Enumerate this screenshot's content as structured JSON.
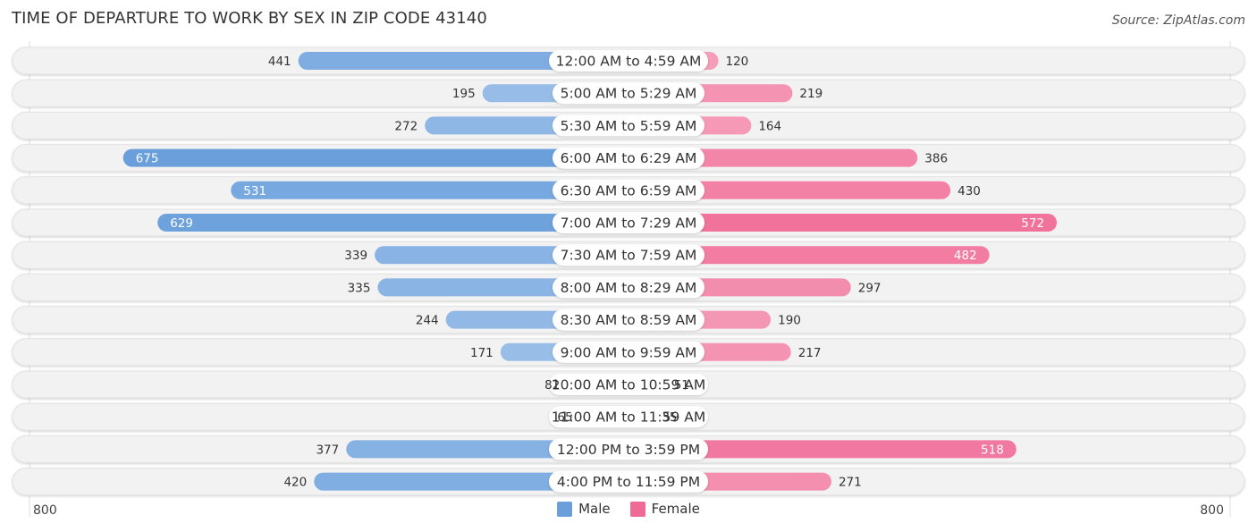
{
  "header": {
    "title": "TIME OF DEPARTURE TO WORK BY SEX IN ZIP CODE 43140",
    "source": "Source: ZipAtlas.com"
  },
  "colors": {
    "male": "#6a9fdc",
    "male_light": "#a8c8ec",
    "female": "#f06a96",
    "female_light": "#f6a8c0",
    "track": "#f2f2f2"
  },
  "legend": {
    "male_label": "Male",
    "female_label": "Female"
  },
  "axis": {
    "left_label": "800",
    "right_label": "800"
  },
  "chart_data": {
    "type": "bar",
    "orientation": "horizontal-diverging",
    "title": "TIME OF DEPARTURE TO WORK BY SEX IN ZIP CODE 43140",
    "xlabel": "",
    "ylabel": "",
    "xlim": [
      -800,
      800
    ],
    "legend_position": "bottom-center",
    "categories": [
      "12:00 AM to 4:59 AM",
      "5:00 AM to 5:29 AM",
      "5:30 AM to 5:59 AM",
      "6:00 AM to 6:29 AM",
      "6:30 AM to 6:59 AM",
      "7:00 AM to 7:29 AM",
      "7:30 AM to 7:59 AM",
      "8:00 AM to 8:29 AM",
      "8:30 AM to 8:59 AM",
      "9:00 AM to 9:59 AM",
      "10:00 AM to 10:59 AM",
      "11:00 AM to 11:59 AM",
      "12:00 PM to 3:59 PM",
      "4:00 PM to 11:59 PM"
    ],
    "series": [
      {
        "name": "Male",
        "values": [
          441,
          195,
          272,
          675,
          531,
          629,
          339,
          335,
          244,
          171,
          82,
          65,
          377,
          420
        ]
      },
      {
        "name": "Female",
        "values": [
          120,
          219,
          164,
          386,
          430,
          572,
          482,
          297,
          190,
          217,
          51,
          35,
          518,
          271
        ]
      }
    ]
  }
}
